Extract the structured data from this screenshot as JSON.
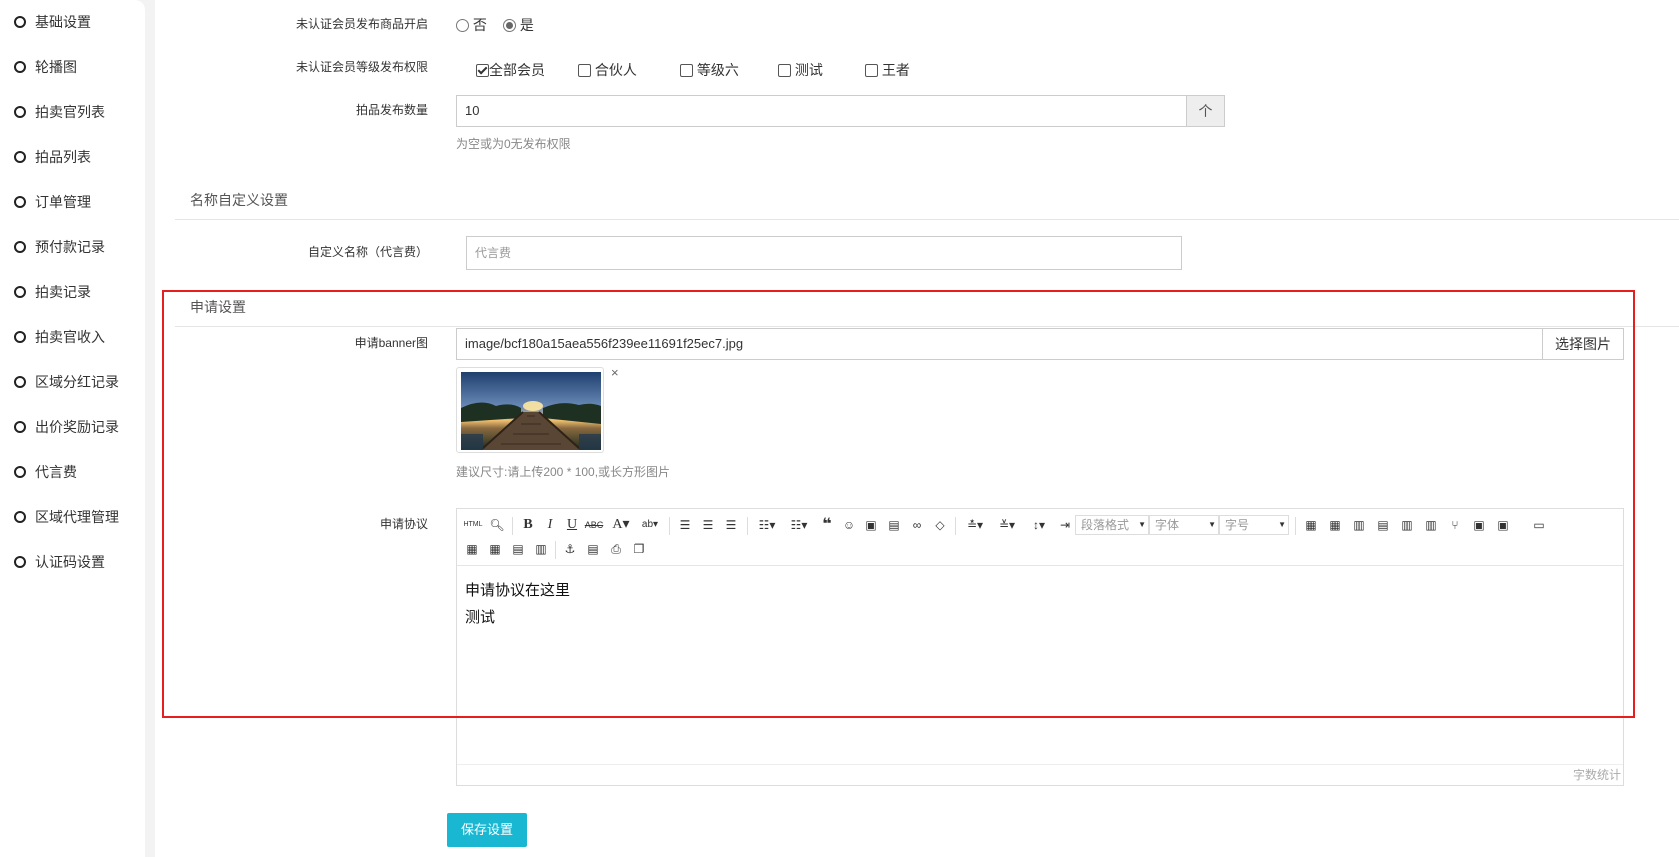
{
  "sidebar": {
    "items": [
      {
        "label": "基础设置"
      },
      {
        "label": "轮播图"
      },
      {
        "label": "拍卖官列表"
      },
      {
        "label": "拍品列表"
      },
      {
        "label": "订单管理"
      },
      {
        "label": "预付款记录"
      },
      {
        "label": "拍卖记录"
      },
      {
        "label": "拍卖官收入"
      },
      {
        "label": "区域分红记录"
      },
      {
        "label": "出价奖励记录"
      },
      {
        "label": "代言费"
      },
      {
        "label": "区域代理管理"
      },
      {
        "label": "认证码设置"
      }
    ]
  },
  "form": {
    "publish_toggle": {
      "label": "未认证会员发布商品开启",
      "options": [
        {
          "label": "否",
          "selected": false
        },
        {
          "label": "是",
          "selected": true
        }
      ]
    },
    "level_permission": {
      "label": "未认证会员等级发布权限",
      "options": [
        {
          "label": "全部会员",
          "checked": true
        },
        {
          "label": "合伙人",
          "checked": false
        },
        {
          "label": "等级六",
          "checked": false
        },
        {
          "label": "测试",
          "checked": false
        },
        {
          "label": "王者",
          "checked": false
        }
      ]
    },
    "publish_count": {
      "label": "拍品发布数量",
      "value": "10",
      "addon": "个",
      "help": "为空或为0无发布权限"
    }
  },
  "custom_name_section": {
    "title": "名称自定义设置",
    "field_label": "自定义名称（代言费）",
    "placeholder": "代言费"
  },
  "apply_section": {
    "title": "申请设置",
    "banner": {
      "label": "申请banner图",
      "value": "image/bcf180a15aea556f239ee11691f25ec7.jpg",
      "button": "选择图片",
      "remove": "×",
      "help": "建议尺寸:请上传200 * 100,或长方形图片"
    },
    "agreement": {
      "label": "申请协议",
      "combo_paragraph": "段落格式",
      "combo_font": "字体",
      "combo_size": "字号",
      "content_lines": [
        "申请协议在这里",
        "测试"
      ],
      "word_count": "字数统计"
    }
  },
  "save_button": "保存设置",
  "colors": {
    "accent": "#1ab7d3",
    "highlight_border": "#e61e1e"
  }
}
